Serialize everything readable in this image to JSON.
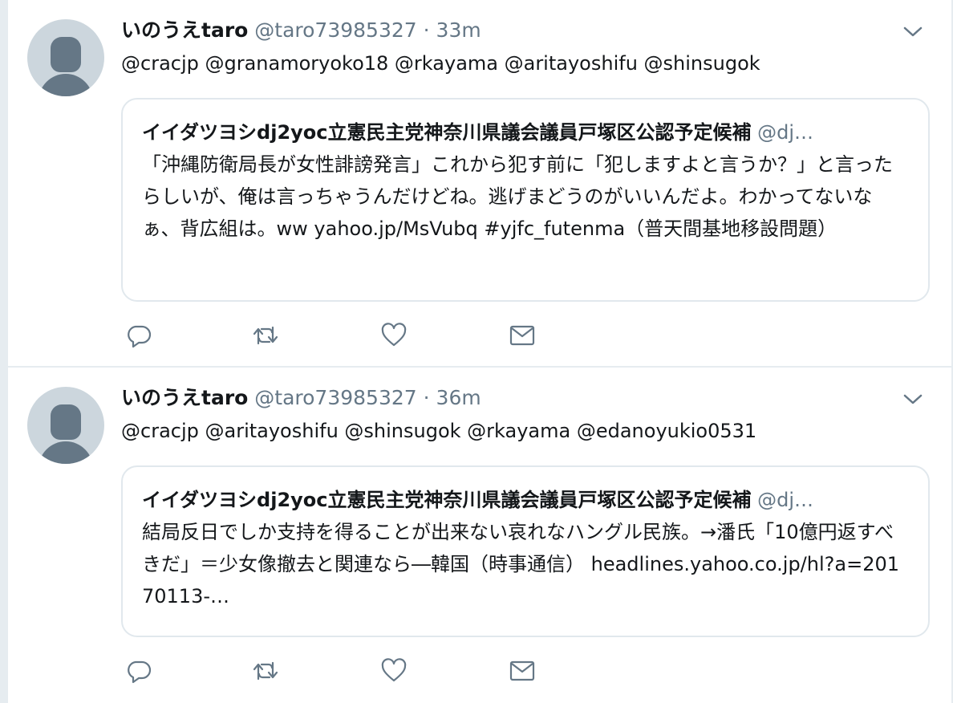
{
  "tweets": [
    {
      "name": "いのうえtaro",
      "handle": "@taro73985327",
      "separator": "·",
      "time": "33m",
      "mentions": "@cracjp @granamoryoko18 @rkayama @aritayoshifu @shinsugok",
      "quote": {
        "name": "イイダツヨシdj2yoc立憲民主党神奈川県議会議員戸塚区公認予定候補",
        "handle": "@dj…",
        "text": "「沖縄防衛局長が女性誹謗発言」これから犯す前に「犯しますよと言うか？」と言ったらしいが、俺は言っちゃうんだけどね。逃げまどうのがいいんだよ。わかってないなぁ、背広組は。ww yahoo.jp/MsVubq #yjfc_futenma（普天間基地移設問題）"
      }
    },
    {
      "name": "いのうえtaro",
      "handle": "@taro73985327",
      "separator": "·",
      "time": "36m",
      "mentions": "@cracjp @aritayoshifu @shinsugok @rkayama @edanoyukio0531",
      "quote": {
        "name": "イイダツヨシdj2yoc立憲民主党神奈川県議会議員戸塚区公認予定候補",
        "handle": "@dj…",
        "text": "結局反日でしか支持を得ることが出来ない哀れなハングル民族。→潘氏「10億円返すべきだ」＝少女像撤去と関連なら―韓国（時事通信） headlines.yahoo.co.jp/hl?a=20170113-…"
      }
    }
  ],
  "icons": {
    "reply": "reply-icon",
    "retweet": "retweet-icon",
    "like": "heart-icon",
    "dm": "envelope-icon",
    "menu": "chevron-down-icon"
  },
  "colors": {
    "icon": "#657786",
    "secondary_text": "#657786",
    "border": "#e1e8ed",
    "avatar_bg": "#ccd6dd"
  }
}
